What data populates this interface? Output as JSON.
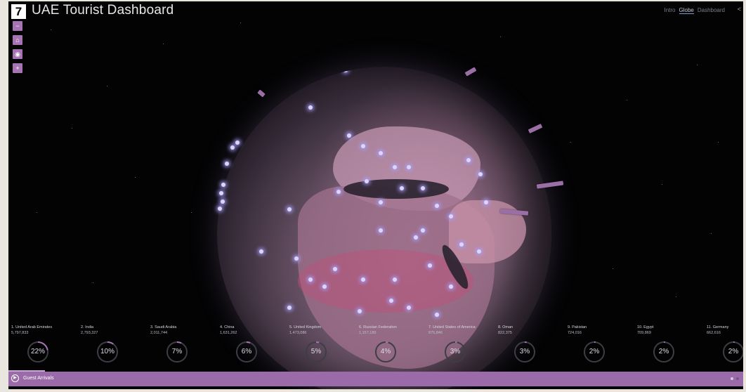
{
  "app": {
    "logo": "7",
    "title": "UAE Tourist Dashboard"
  },
  "nav": {
    "tabs": [
      {
        "label": "Intro",
        "active": false
      },
      {
        "label": "Globe",
        "active": true
      },
      {
        "label": "Dashboard",
        "active": false
      }
    ],
    "extra_icon": "share-icon"
  },
  "tools": [
    {
      "icon": "minus-icon",
      "glyph": "−"
    },
    {
      "icon": "home-icon",
      "glyph": "⌂"
    },
    {
      "icon": "compass-icon",
      "glyph": "◉"
    },
    {
      "icon": "plus-icon",
      "glyph": "+"
    }
  ],
  "countries": [
    {
      "name": "1. United Arab Emirates",
      "count": "5,797,833",
      "percent": "22%",
      "fraction": 0.22
    },
    {
      "name": "2. India",
      "count": "2,793,327",
      "percent": "10%",
      "fraction": 0.1
    },
    {
      "name": "3. Saudi Arabia",
      "count": "2,011,744",
      "percent": "7%",
      "fraction": 0.07
    },
    {
      "name": "4. China",
      "count": "1,631,262",
      "percent": "6%",
      "fraction": 0.06
    },
    {
      "name": "5. United Kingdom",
      "count": "1,473,086",
      "percent": "5%",
      "fraction": 0.05
    },
    {
      "name": "6. Russian Federation",
      "count": "1,157,189",
      "percent": "4%",
      "fraction": 0.04
    },
    {
      "name": "7. United States of America",
      "count": "875,846",
      "percent": "3%",
      "fraction": 0.03
    },
    {
      "name": "8. Oman",
      "count": "822,375",
      "percent": "3%",
      "fraction": 0.03
    },
    {
      "name": "9. Pakistan",
      "count": "724,016",
      "percent": "2%",
      "fraction": 0.02
    },
    {
      "name": "10. Egypt",
      "count": "709,869",
      "percent": "2%",
      "fraction": 0.02
    },
    {
      "name": "11. Germany",
      "count": "662,616",
      "percent": "2%",
      "fraction": 0.02
    }
  ],
  "bottombar": {
    "play_icon": "play-icon",
    "label": "Guest Arrivals",
    "progress": 0.05,
    "pages": [
      {
        "active": true
      },
      {
        "active": false
      }
    ]
  },
  "colors": {
    "accent": "#9b6aa9",
    "ring_track": "#3d3d45",
    "ring_fill": "#a774b3",
    "city_dot": "#dcd6ff"
  }
}
